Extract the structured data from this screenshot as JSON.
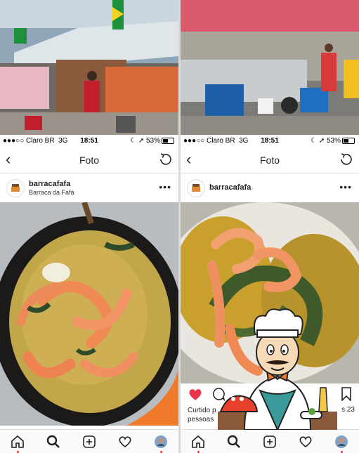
{
  "status_bar": {
    "carrier": "●●●○○ Claro BR",
    "network": "3G",
    "time": "18:51",
    "battery": "53%"
  },
  "left_screen": {
    "nav": {
      "title": "Foto"
    },
    "post": {
      "username": "barracafafa",
      "location": "Barraca da Fafá"
    }
  },
  "right_screen": {
    "nav": {
      "title": "Foto"
    },
    "post": {
      "username": "barracafafa"
    },
    "likes": {
      "line1": "Curtido p",
      "line2": "pessoas",
      "tail": "s 23"
    }
  },
  "colors": {
    "like_red": "#e8334a",
    "accent_orange": "#f07a2a",
    "mustard": "#c99a2a"
  }
}
